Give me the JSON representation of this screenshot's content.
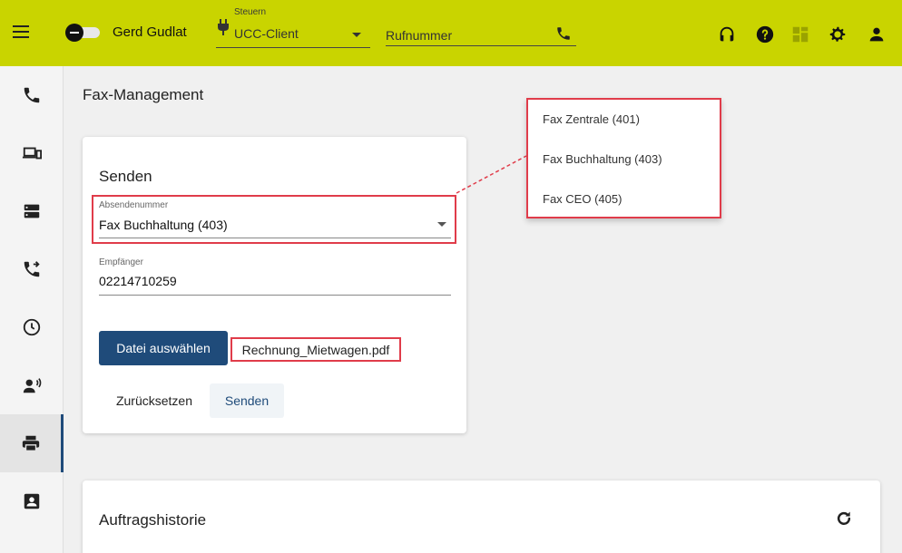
{
  "topbar": {
    "user_name": "Gerd Gudlat",
    "control_label": "Steuern",
    "control_value": "UCC-Client",
    "phone_placeholder": "Rufnummer"
  },
  "page": {
    "title": "Fax-Management"
  },
  "send_card": {
    "title": "Senden",
    "sender_label": "Absendenummer",
    "sender_value": "Fax Buchhaltung (403)",
    "recipient_label": "Empfänger",
    "recipient_value": "02214710259",
    "choose_file_label": "Datei auswählen",
    "file_name": "Rechnung_Mietwagen.pdf",
    "reset_label": "Zurücksetzen",
    "send_label": "Senden"
  },
  "dropdown_options": [
    "Fax Zentrale (401)",
    "Fax Buchhaltung (403)",
    "Fax CEO (405)"
  ],
  "history_card": {
    "title": "Auftragshistorie"
  },
  "sidenav": {
    "items": [
      "phone-icon",
      "devices-icon",
      "server-icon",
      "call-forward-icon",
      "clock-icon",
      "voicemail-icon",
      "printer-icon",
      "contact-card-icon"
    ],
    "active": "printer-icon"
  },
  "colors": {
    "topbar": "#c9d400",
    "primary": "#1f4b7a",
    "highlight": "#e03c4a"
  }
}
